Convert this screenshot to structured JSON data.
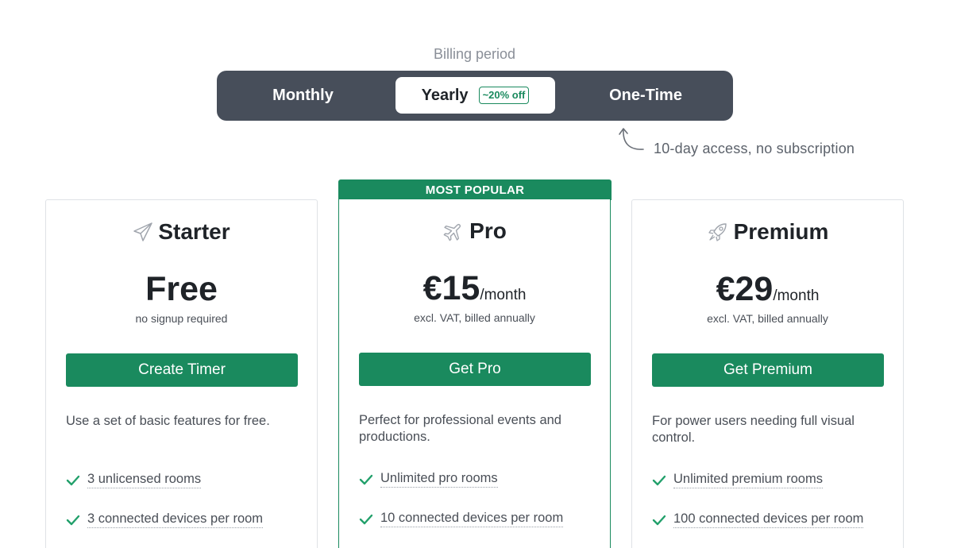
{
  "billing": {
    "label": "Billing period",
    "options": [
      {
        "label": "Monthly"
      },
      {
        "label": "Yearly",
        "badge": "~20% off",
        "selected": true
      },
      {
        "label": "One-Time"
      }
    ],
    "note": "10-day access, no subscription"
  },
  "popular_banner": "MOST POPULAR",
  "plans": [
    {
      "name": "Starter",
      "icon": "paper-plane-icon",
      "price": "Free",
      "period": "",
      "subtext": "no signup required",
      "cta": "Create Timer",
      "description": "Use a set of basic features for free.",
      "features": [
        "3 unlicensed rooms",
        "3 connected devices per room"
      ]
    },
    {
      "name": "Pro",
      "icon": "airplane-icon",
      "price": "€15",
      "period": "/month",
      "subtext": "excl. VAT, billed annually",
      "cta": "Get Pro",
      "description": "Perfect for professional events and productions.",
      "features": [
        "Unlimited pro rooms",
        "10 connected devices per room"
      ]
    },
    {
      "name": "Premium",
      "icon": "rocket-icon",
      "price": "€29",
      "period": "/month",
      "subtext": "excl. VAT, billed annually",
      "cta": "Get Premium",
      "description": "For power users needing full visual control.",
      "features": [
        "Unlimited premium rooms",
        "100 connected devices per room"
      ]
    }
  ],
  "colors": {
    "accent": "#1a8a5e",
    "toggle_bg": "#474e5a",
    "check": "#22a06b"
  }
}
